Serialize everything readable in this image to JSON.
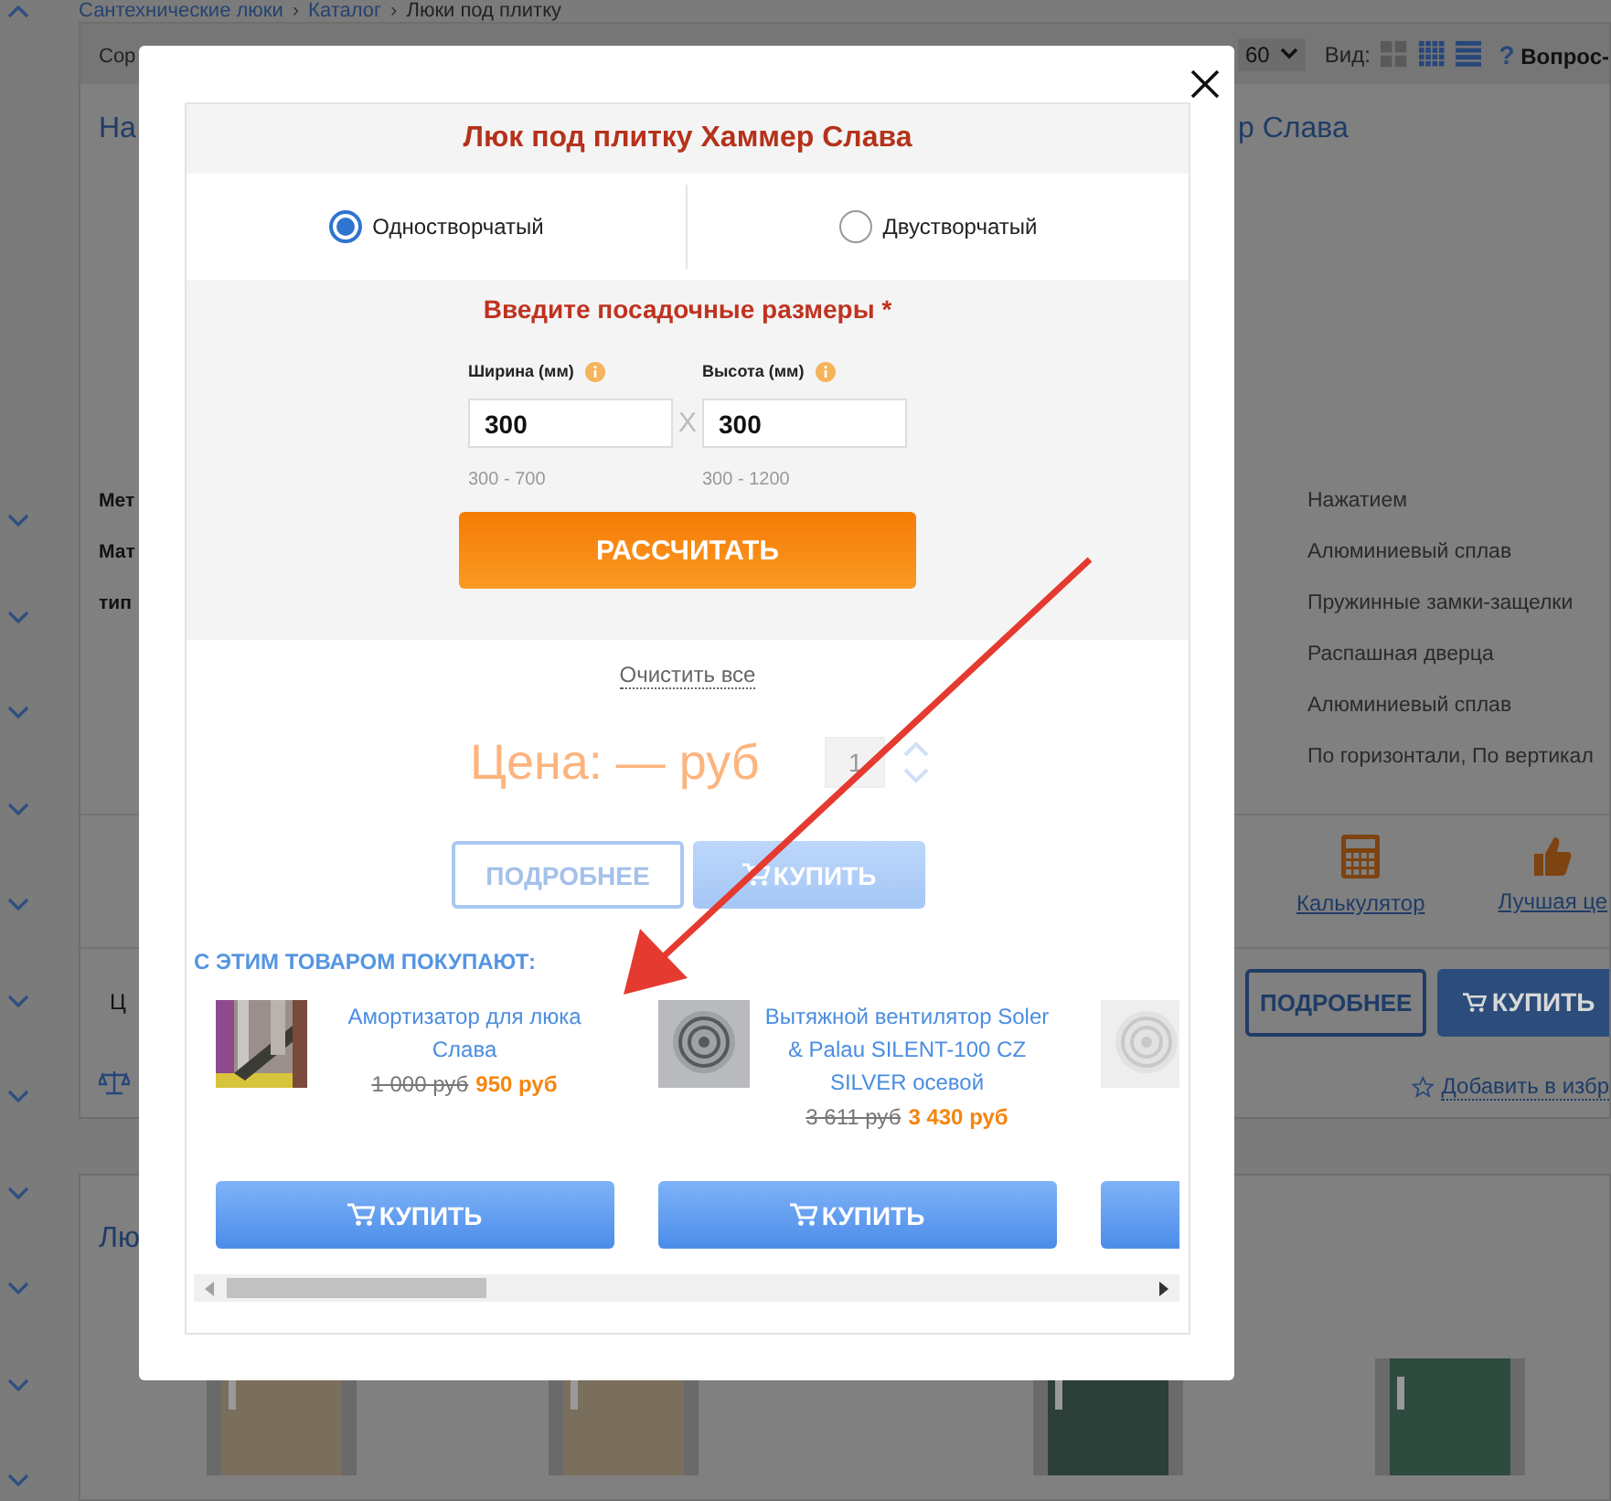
{
  "breadcrumb": {
    "items": [
      "Сантехнические люки",
      "Каталог",
      "Люки под плитку"
    ],
    "separator": "›"
  },
  "toolbar": {
    "sort_label": "Сор",
    "per_page": "60",
    "view_label": "Вид:",
    "help_icon": "?",
    "help": "Вопрос-"
  },
  "title_left": "На",
  "title_right": "р Слава",
  "spec_labels": [
    "Мет",
    "Мат",
    "тип"
  ],
  "spec_values": [
    "Нажатием",
    "Алюминиевый сплав",
    "Пружинные замки-защелки",
    "Распашная дверца",
    "Алюминиевый сплав",
    "По горизонтали, По вертикал"
  ],
  "tools": [
    {
      "kind": "calculator",
      "label": "Калькулятор"
    },
    {
      "kind": "thumb",
      "label": "Лучшая це"
    }
  ],
  "price_label": "Ц",
  "details_button": "ПОДРОБНЕЕ",
  "buy_button": "КУПИТЬ",
  "favorite": "Добавить в избр",
  "section_title": "Лю",
  "modal": {
    "title": "Люк под плитку Хаммер Слава",
    "options": [
      {
        "label": "Одностворчатый",
        "selected": true
      },
      {
        "label": "Двустворчатый",
        "selected": false
      }
    ],
    "sizes_title": "Введите посадочные размеры *",
    "fields": [
      {
        "label": "Ширина (мм)",
        "value": "300",
        "range": "300 - 700"
      },
      {
        "label": "Высота (мм)",
        "value": "300",
        "range": "300 - 1200"
      }
    ],
    "times": "X",
    "calculate": "РАССЧИТАТЬ",
    "clear": "Очистить все",
    "price": "Цена: — руб",
    "quantity": "1",
    "details": "ПОДРОБНЕЕ",
    "buy": "КУПИТЬ",
    "related_title": "С ЭТИМ ТОВАРОМ ПОКУПАЮТ:",
    "related": [
      {
        "kind": "picture",
        "name": "Амортизатор для люка Слава",
        "old_price": "1 000 руб",
        "price": "950 руб",
        "buy": "КУПИТЬ"
      },
      {
        "kind": "picture",
        "name": "Вытяжной вентилятор Soler & Palau SILENT-100 CZ SILVER осевой",
        "old_price": "3 611 руб",
        "price": "3 430 руб",
        "buy": "КУПИТЬ"
      },
      {
        "kind": "picture"
      }
    ]
  }
}
